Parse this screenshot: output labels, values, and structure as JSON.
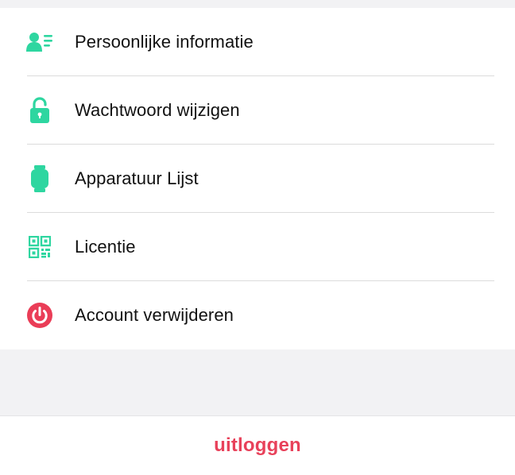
{
  "colors": {
    "accent_green": "#2ed6a0",
    "danger_red": "#ea3d57",
    "background": "#f2f2f4"
  },
  "menu": {
    "items": [
      {
        "label": "Persoonlijke informatie",
        "icon": "user-card-icon"
      },
      {
        "label": "Wachtwoord wijzigen",
        "icon": "lock-icon"
      },
      {
        "label": "Apparatuur Lijst",
        "icon": "watch-icon"
      },
      {
        "label": "Licentie",
        "icon": "qr-code-icon"
      },
      {
        "label": "Account verwijderen",
        "icon": "power-icon"
      }
    ]
  },
  "footer": {
    "logout_label": "uitloggen"
  }
}
